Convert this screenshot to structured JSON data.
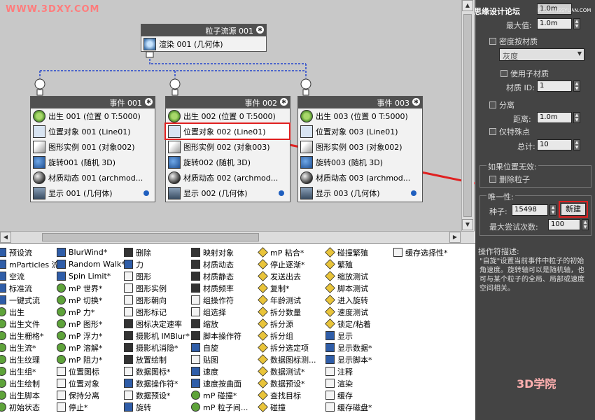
{
  "canvas": {
    "watermark": "WWW.3DXY.COM",
    "source": {
      "title": "粒子流源 001",
      "ops": [
        {
          "icon": "render-icon",
          "label": "渲染 001 (几何体)"
        }
      ]
    },
    "events": [
      {
        "title": "事件 001",
        "ops": [
          {
            "icon": "birth-icon",
            "label": "出生 001 (位置 0 T:5000)"
          },
          {
            "icon": "position-object-icon",
            "label": "位置对象 001 (Line01)"
          },
          {
            "icon": "shape-instance-icon",
            "label": "图形实例 001 (对象002)"
          },
          {
            "icon": "spin-icon",
            "label": "旋转001 (随机 3D)"
          },
          {
            "icon": "material-icon",
            "label": "材质动态 001 (archmod..."
          },
          {
            "icon": "display-icon",
            "label": "显示 001 (几何体)"
          }
        ]
      },
      {
        "title": "事件 002",
        "ops": [
          {
            "icon": "birth-icon",
            "label": "出生 002 (位置 0 T:5000)"
          },
          {
            "icon": "position-object-icon",
            "label": "位置对象 002 (Line01)"
          },
          {
            "icon": "shape-instance-icon",
            "label": "图形实例 002 (对象003)"
          },
          {
            "icon": "spin-icon",
            "label": "旋转002 (随机 3D)"
          },
          {
            "icon": "material-icon",
            "label": "材质动态 002 (archmod..."
          },
          {
            "icon": "display-icon",
            "label": "显示 002 (几何体)"
          }
        ]
      },
      {
        "title": "事件 003",
        "ops": [
          {
            "icon": "birth-icon",
            "label": "出生 003 (位置 0 T:5000)"
          },
          {
            "icon": "position-object-icon",
            "label": "位置对象 003 (Line01)"
          },
          {
            "icon": "shape-instance-icon",
            "label": "图形实例 003 (对象002)"
          },
          {
            "icon": "spin-icon",
            "label": "旋转003 (随机 3D)"
          },
          {
            "icon": "material-icon",
            "label": "材质动态 003 (archmod..."
          },
          {
            "icon": "display-icon",
            "label": "显示 003 (几何体)"
          }
        ]
      }
    ]
  },
  "panel": {
    "header_watermark": "思缘设计论坛",
    "header_watermark_url": "WWW.MISSYUAN.COM",
    "top_spinner_value": "1.0m",
    "max_label": "最大值:",
    "max_value": "1.0m",
    "density_by_material": "密度按材质",
    "gray_dropdown": "灰度",
    "use_sub_material": "使用子材质",
    "material_id_label": "材质 ID:",
    "material_id_value": "1",
    "subdivide": "分离",
    "distance_label": "距离:",
    "distance_value": "1.0m",
    "distinct_points": "仅特殊点",
    "total_label": "总计:",
    "total_value": "10",
    "invalid_location_group": "如果位置无效:",
    "delete_particles": "删除粒子",
    "uniqueness_group": "唯一性:",
    "seed_label": "种子:",
    "seed_value": "15498",
    "new_button": "新建",
    "max_attempts_label": "最大尝试次数:",
    "max_attempts_value": "100",
    "accent_color": "#e02020"
  },
  "description": {
    "label": "操作符描述:",
    "text": "\"自旋\"设置当前事件中粒子的初始角速度。旋转轴可以是随机轴，也可与某个粒子的全局、局部或速度空间相关。",
    "logo": "3D学院"
  },
  "depot": {
    "columns": [
      [
        "预设流",
        "mParticles 流*",
        "空流",
        "标准流",
        "一键式流",
        "出生",
        "出生文件",
        "出生栅格*",
        "出生流*",
        "出生纹理",
        "出生组*",
        "出生绘制",
        "出生脚本",
        "初始状态"
      ],
      [
        "BlurWind*",
        "Random Walk*",
        "Spin Limit*",
        "mP 世界*",
        "mP 切换*",
        "mP 力*",
        "mP 图形*",
        "mP 浮力*",
        "mP 溶解*",
        "mP 阻力*",
        "位置图标",
        "位置对象",
        "保持分离",
        "停止*"
      ],
      [
        "删除",
        "力",
        "图形",
        "图形实例",
        "图形朝向",
        "图形标记",
        "图标决定速率",
        "摄影机 IMBlur*",
        "摄影机消隐*",
        "放置绘制",
        "数据图标*",
        "数据操作符*",
        "数据预设*",
        "旋转"
      ],
      [
        "映射对象",
        "材质动态",
        "材质静态",
        "材质频率",
        "组操作符",
        "组选择",
        "缩放",
        "脚本操作符",
        "自旋",
        "贴图",
        "速度",
        "速度按曲面",
        "mP 碰撞*",
        "mP 粒子间..."
      ],
      [
        "mP 粘合*",
        "停止逐渐*",
        "发送出去",
        "复制*",
        "年龄测试",
        "拆分数量",
        "拆分源",
        "拆分组",
        "拆分选定项",
        "数据图标测...",
        "数据测试*",
        "数据预设*",
        "查找目标",
        "碰撞"
      ],
      [
        "碰撞繁殖",
        "繁殖",
        "缩放测试",
        "脚本测试",
        "进入旋转",
        "速度测试",
        "锁定/粘着",
        "显示",
        "显示数据*",
        "显示脚本*",
        "注释",
        "渲染",
        "缓存",
        "缓存磁盘*"
      ],
      [
        "缓存选择性*"
      ]
    ]
  }
}
